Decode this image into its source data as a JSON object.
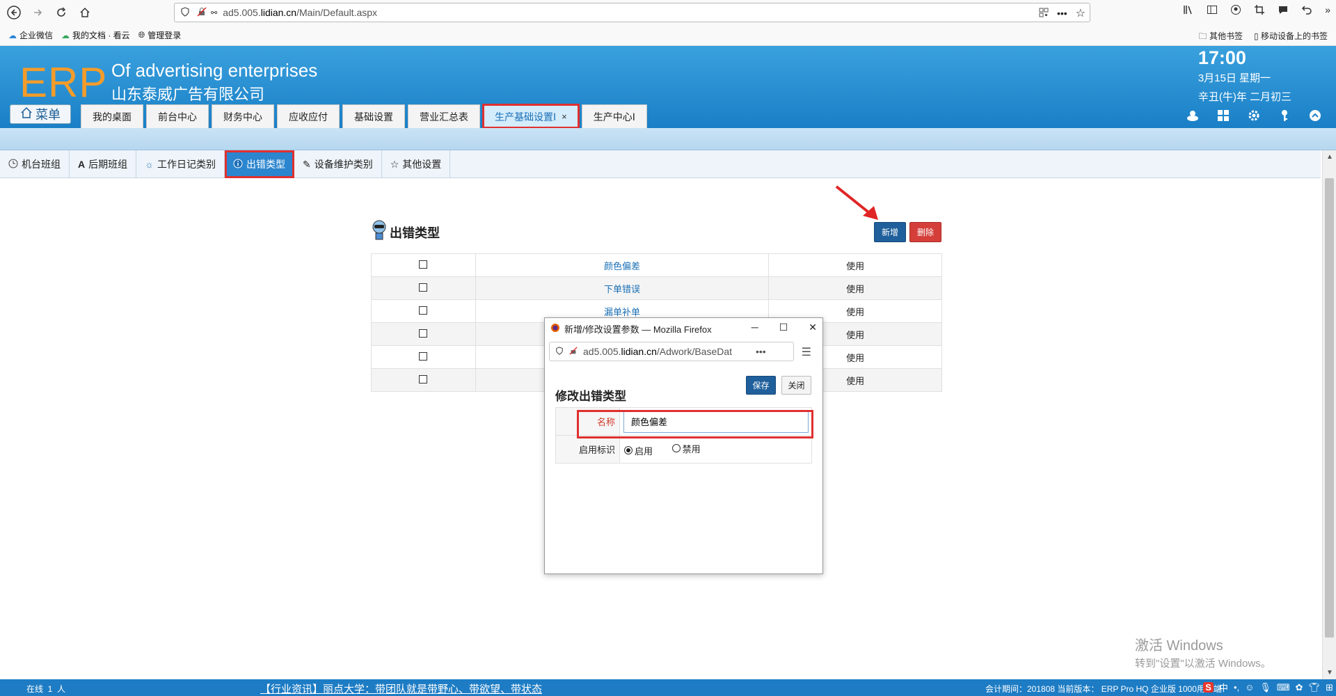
{
  "browser": {
    "url_prefix": "ad5.005.",
    "url_domain": "lidian.cn",
    "url_path": "/Main/Default.aspx",
    "bookmarks": [
      "企业微信",
      "我的文档 · 看云",
      "管理登录"
    ],
    "bookmarks_right": [
      "其他书签",
      "移动设备上的书签"
    ]
  },
  "header": {
    "logo": "ERP",
    "subtitle_en": "Of advertising enterprises",
    "subtitle_cn": "山东泰威广告有限公司",
    "menu_label": "菜单",
    "tabs": [
      {
        "label": "我的桌面"
      },
      {
        "label": "前台中心"
      },
      {
        "label": "财务中心"
      },
      {
        "label": "应收应付"
      },
      {
        "label": "基础设置"
      },
      {
        "label": "营业汇总表"
      },
      {
        "label": "生产基础设置Ⅰ",
        "active": true,
        "close": "×"
      },
      {
        "label": "生产中心Ⅰ"
      }
    ],
    "clock": {
      "time": "17:00",
      "date": "3月15日 星期一",
      "lunar": "辛丑(牛)年 二月初三"
    }
  },
  "subtabs": [
    {
      "label": "机台班组",
      "icon": "clock-icon"
    },
    {
      "label": "后期班组",
      "icon": "letter-a-icon"
    },
    {
      "label": "工作日记类别",
      "icon": "gear-icon"
    },
    {
      "label": "出错类型",
      "icon": "info-icon",
      "active": true
    },
    {
      "label": "设备维护类别",
      "icon": "pencil-icon"
    },
    {
      "label": "其他设置",
      "icon": "star-icon"
    }
  ],
  "content": {
    "title": "出错类型",
    "add_label": "新增",
    "delete_label": "删除",
    "rows": [
      {
        "name": "颜色偏差",
        "status": "使用"
      },
      {
        "name": "下单错误",
        "status": "使用"
      },
      {
        "name": "漏单补单",
        "status": "使用"
      },
      {
        "name": "",
        "status": "使用"
      },
      {
        "name": "",
        "status": "使用"
      },
      {
        "name": "",
        "status": "使用"
      }
    ]
  },
  "popup": {
    "title": "新增/修改设置参数 — Mozilla Firefox",
    "url_prefix": "ad5.005.",
    "url_domain": "lidian.cn",
    "url_path": "/Adwork/BaseDat",
    "heading": "修改出错类型",
    "save_label": "保存",
    "close_label": "关闭",
    "name_label": "名称",
    "name_value": "颜色偏差",
    "enable_label": "启用标识",
    "radio_enable": "启用",
    "radio_disable": "禁用"
  },
  "statusbar": {
    "online": "在线  1  人",
    "marquee": "【行业资讯】丽点大学：带团队就是带野心、带欲望、带状态",
    "info": "会计期间：201808  当前版本：  ERP Pro HQ 企业版 1000用户端",
    "ime": "中"
  },
  "watermark": {
    "line1": "激活 Windows",
    "line2": "转到\"设置\"以激活 Windows。"
  },
  "colors": {
    "header": "#1a7fc6",
    "active_subtab": "#2c86cf",
    "annotation": "#e03030",
    "logo": "#f39c2b"
  }
}
